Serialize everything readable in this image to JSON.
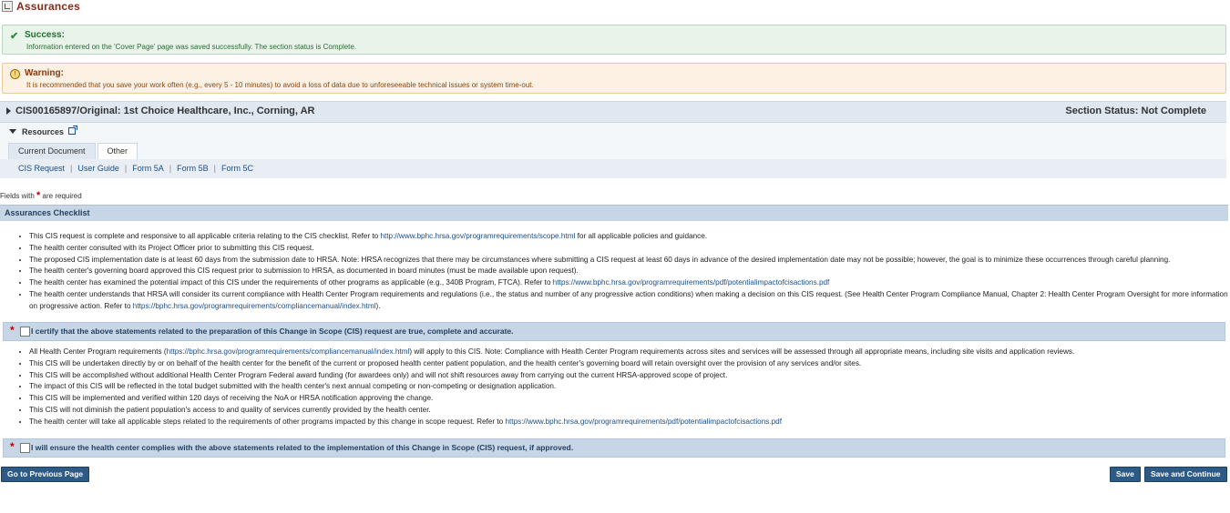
{
  "page": {
    "title": "Assurances"
  },
  "alerts": {
    "success": {
      "heading": "Success:",
      "message": "Information entered on the 'Cover Page' page was saved successfully. The section status is Complete."
    },
    "warning": {
      "heading": "Warning:",
      "message": "It is recommended that you save your work often (e.g., every 5 - 10 minutes) to avoid a loss of data due to unforeseeable technical issues or system time-out."
    }
  },
  "cis_header": {
    "title": "CIS00165897/Original: 1st Choice Healthcare, Inc., Corning, AR",
    "status": "Section Status: Not Complete"
  },
  "resources": {
    "label": "Resources",
    "tabs": [
      {
        "label": "Current Document"
      },
      {
        "label": "Other"
      }
    ],
    "links": [
      {
        "label": "CIS Request"
      },
      {
        "label": "User Guide"
      },
      {
        "label": "Form 5A"
      },
      {
        "label": "Form 5B"
      },
      {
        "label": "Form 5C"
      }
    ]
  },
  "required_note": {
    "before": "Fields with",
    "star": "*",
    "after": "are required"
  },
  "checklist": {
    "header": "Assurances Checklist",
    "items1": [
      {
        "pre": "This CIS request is complete and responsive to all applicable criteria relating to the CIS checklist. Refer to ",
        "link": "http://www.bphc.hrsa.gov/programrequirements/scope.html",
        "post": " for all applicable policies and guidance."
      },
      {
        "pre": "The health center consulted with its Project Officer prior to submitting this CIS request.",
        "link": "",
        "post": ""
      },
      {
        "pre": "The proposed CIS implementation date is at least 60 days from the submission date to HRSA. Note: HRSA recognizes that there may be circumstances where submitting a CIS request at least 60 days in advance of the desired implementation date may not be possible; however, the goal is to minimize these occurrences through careful planning.",
        "link": "",
        "post": ""
      },
      {
        "pre": "The health center's governing board approved this CIS request prior to submission to HRSA, as documented in board minutes (must be made available upon request).",
        "link": "",
        "post": ""
      },
      {
        "pre": "The health center has examined the potential impact of this CIS under the requirements of other programs as applicable (e.g., 340B Program, FTCA). Refer to ",
        "link": "https://www.bphc.hrsa.gov/programrequirements/pdf/potentialimpactofcisactions.pdf",
        "post": ""
      },
      {
        "pre": "The health center understands that HRSA will consider its current compliance with Health Center Program requirements and regulations (i.e., the status and number of any progressive action conditions) when making a decision on this CIS request. (See Health Center Program Compliance Manual, Chapter 2: Health Center Program Oversight for more information on progressive action. Refer to ",
        "link": "https://bphc.hrsa.gov/programrequirements/compliancemanual/index.html",
        "post": ")."
      }
    ],
    "cert1": "I certify that the above statements related to the preparation of this Change in Scope (CIS) request are true, complete and accurate.",
    "items2": [
      {
        "pre": "All Health Center Program requirements (",
        "link": "https://bphc.hrsa.gov/programrequirements/compliancemanual/index.html",
        "post": ") will apply to this CIS. Note: Compliance with Health Center Program requirements across sites and services will be assessed through all appropriate means, including site visits and application reviews."
      },
      {
        "pre": "This CIS will be undertaken directly by or on behalf of the health center for the benefit of the current or proposed health center patient population, and the health center's governing board will retain oversight over the provision of any services and/or sites.",
        "link": "",
        "post": ""
      },
      {
        "pre": "This CIS will be accomplished without additional Health Center Program Federal award funding (for awardees only) and will not shift resources away from carrying out the current HRSA-approved scope of project.",
        "link": "",
        "post": ""
      },
      {
        "pre": "The impact of this CIS will be reflected in the total budget submitted with the health center's next annual competing or non-competing or designation application.",
        "link": "",
        "post": ""
      },
      {
        "pre": "This CIS will be implemented and verified within 120 days of receiving the NoA or HRSA notification approving the change.",
        "link": "",
        "post": ""
      },
      {
        "pre": "This CIS will not diminish the patient population's access to and quality of services currently provided by the health center.",
        "link": "",
        "post": ""
      },
      {
        "pre": "The health center will take all applicable steps related to the requirements of other programs impacted by this change in scope request. Refer to ",
        "link": "https://www.bphc.hrsa.gov/programrequirements/pdf/potentialimpactofcisactions.pdf",
        "post": ""
      }
    ],
    "cert2": "I will ensure the health center complies with the above statements related to the implementation of this Change in Scope (CIS) request, if approved."
  },
  "buttons": {
    "prev": "Go to Previous Page",
    "save": "Save",
    "save_continue": "Save and Continue"
  }
}
